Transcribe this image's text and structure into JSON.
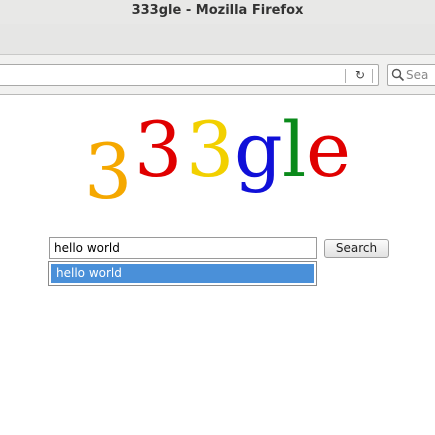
{
  "window": {
    "title": "333gle - Mozilla Firefox"
  },
  "toolbar": {
    "url_value": "",
    "reload_icon": "reload-icon",
    "search_placeholder": "Sea",
    "search_icon": "magnifier-icon"
  },
  "page": {
    "logo": {
      "letters": [
        "3",
        "3",
        "3",
        "g",
        "l",
        "e"
      ],
      "colors": [
        "#f5a800",
        "#e00000",
        "#f2d000",
        "#1010d8",
        "#0a8a1a",
        "#e00000"
      ]
    },
    "query_value": "hello world",
    "search_button_label": "Search",
    "suggestions": [
      "hello world"
    ],
    "suggestion_highlight_color": "#4a90d9"
  }
}
